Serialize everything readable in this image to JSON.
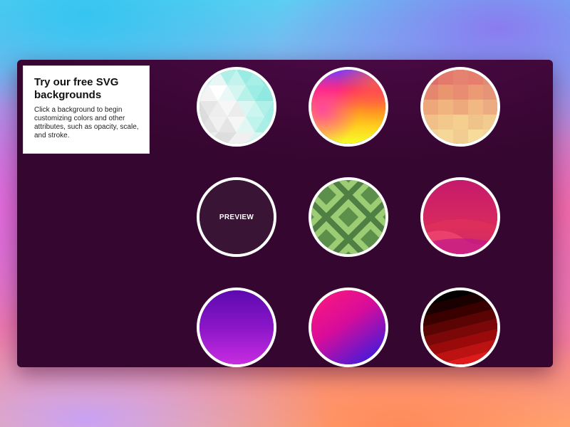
{
  "info": {
    "title": "Try our free SVG backgrounds",
    "description": "Click a background to begin customizing colors and other attributes, such as opacity, scale, and stroke."
  },
  "swatches": [
    {
      "id": "low-poly-mint",
      "colors": [
        "#bff5ee",
        "#8ee9e2",
        "#f2f2f2"
      ]
    },
    {
      "id": "rainbow-mesh",
      "colors": [
        "#7a3cff",
        "#ff2a6a",
        "#ffd21e",
        "#f5ff2a"
      ]
    },
    {
      "id": "pixel-peach",
      "colors": [
        "#e07a6e",
        "#f0a37a",
        "#f3cf92"
      ]
    },
    {
      "id": "preview",
      "label": "PREVIEW",
      "colors": [
        "#3a1434"
      ]
    },
    {
      "id": "green-diamonds",
      "colors": [
        "#5b8f4a",
        "#9ccc74",
        "#3e6b35"
      ]
    },
    {
      "id": "magenta-waves",
      "colors": [
        "#c51a6c",
        "#e3345a",
        "#ff5a7c"
      ]
    },
    {
      "id": "violet-gradient",
      "colors": [
        "#5c0ab0",
        "#a31fd6",
        "#c82ce0"
      ]
    },
    {
      "id": "pink-blue-gradient",
      "colors": [
        "#ff1a7a",
        "#d80c9a",
        "#4a1ad8"
      ]
    },
    {
      "id": "red-stripes",
      "colors": [
        "#000000",
        "#3a0000",
        "#9a0a0a",
        "#e01a1a"
      ]
    }
  ]
}
